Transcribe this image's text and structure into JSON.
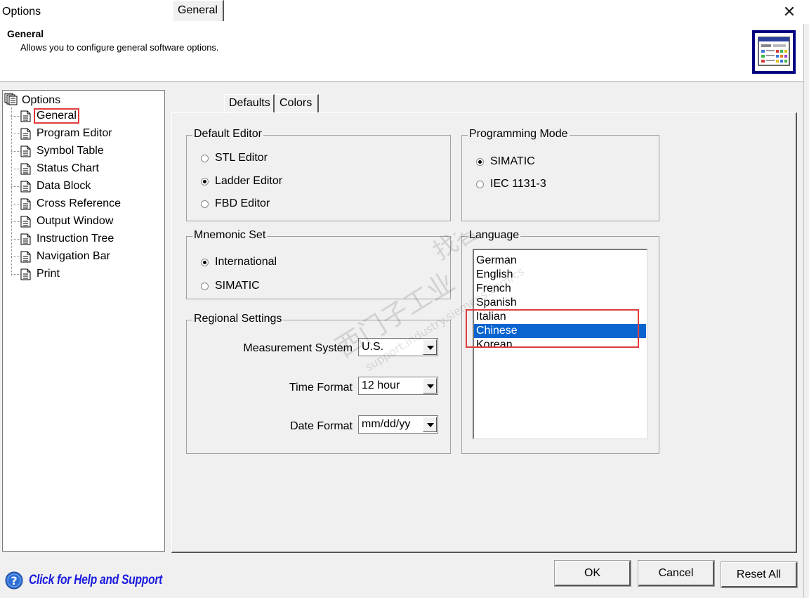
{
  "window": {
    "title": "Options",
    "close_glyph": "✕"
  },
  "header": {
    "title": "General",
    "description": "Allows you to configure general software options.",
    "icon": "settings-window-icon"
  },
  "tree": {
    "root": "Options",
    "items": [
      {
        "label": "General",
        "selected": true
      },
      {
        "label": "Program Editor"
      },
      {
        "label": "Symbol Table"
      },
      {
        "label": "Status Chart"
      },
      {
        "label": "Data Block"
      },
      {
        "label": "Cross Reference"
      },
      {
        "label": "Output Window"
      },
      {
        "label": "Instruction Tree"
      },
      {
        "label": "Navigation Bar"
      },
      {
        "label": "Print"
      }
    ]
  },
  "tabs": [
    {
      "label": "General",
      "active": true
    },
    {
      "label": "Defaults"
    },
    {
      "label": "Colors"
    }
  ],
  "default_editor": {
    "legend": "Default Editor",
    "options": [
      {
        "label": "STL Editor",
        "checked": false
      },
      {
        "label": "Ladder Editor",
        "checked": true
      },
      {
        "label": "FBD Editor",
        "checked": false
      }
    ]
  },
  "programming_mode": {
    "legend": "Programming Mode",
    "options": [
      {
        "label": "SIMATIC",
        "checked": true
      },
      {
        "label": "IEC 1131-3",
        "checked": false
      }
    ]
  },
  "mnemonic_set": {
    "legend": "Mnemonic Set",
    "options": [
      {
        "label": "International",
        "checked": true
      },
      {
        "label": "SIMATIC",
        "checked": false
      }
    ]
  },
  "regional_settings": {
    "legend": "Regional Settings",
    "measurement_label": "Measurement System",
    "measurement_value": "U.S.",
    "time_label": "Time Format",
    "time_value": "12 hour",
    "date_label": "Date Format",
    "date_value": "mm/dd/yy"
  },
  "language": {
    "legend": "Language",
    "options": [
      "German",
      "English",
      "French",
      "Spanish",
      "Italian",
      "Chinese",
      "Korean"
    ],
    "selected": "Chinese"
  },
  "buttons": {
    "ok": "OK",
    "cancel": "Cancel",
    "reset_all": "Reset All"
  },
  "help": {
    "label": "Click for Help and Support"
  },
  "watermark": {
    "line1": "西门子工业",
    "line2": "support.industry.siemens.com/cs",
    "line3": "找答案"
  },
  "colors": {
    "selection": "#0a64d0",
    "annotation_red": "#e03c3c",
    "header_icon_border": "#000080",
    "help_link": "#1a1ae0"
  }
}
